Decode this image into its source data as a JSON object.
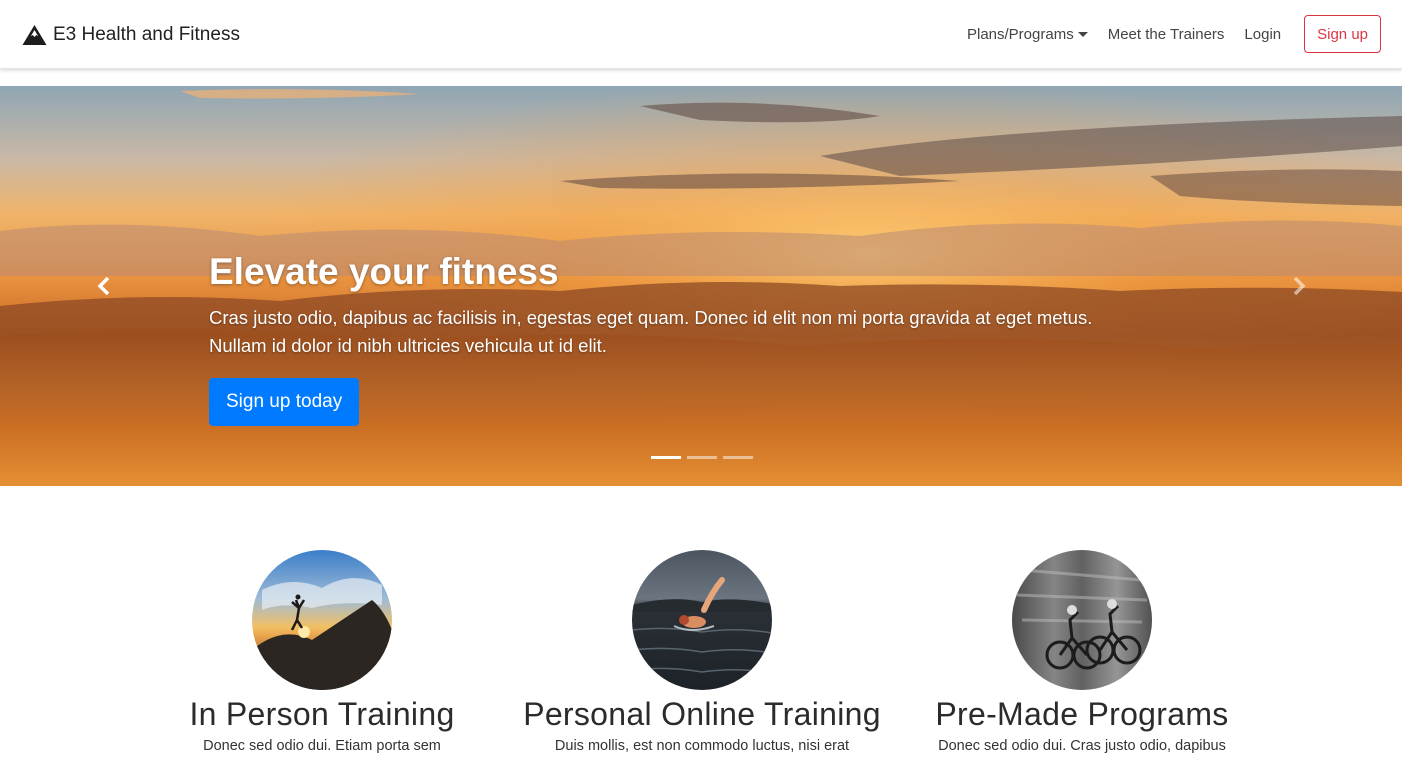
{
  "brand": {
    "name": "E3 Health and Fitness",
    "icon": "mountain-icon"
  },
  "nav": {
    "plans": "Plans/Programs",
    "trainers": "Meet the Trainers",
    "login": "Login",
    "signup": "Sign up"
  },
  "hero": {
    "title": "Elevate your fitness",
    "text_line1": "Cras justo odio, dapibus ac facilisis in, egestas eget quam. Donec id elit non mi porta gravida at eget metus.",
    "text_line2": "Nullam id dolor id nibh ultricies vehicula ut id elit.",
    "cta": "Sign up today",
    "slide_count": 3,
    "active_slide": 1
  },
  "features": [
    {
      "title": "In Person Training",
      "text": "Donec sed odio dui. Etiam porta sem"
    },
    {
      "title": "Personal Online Training",
      "text": "Duis mollis, est non commodo luctus, nisi erat"
    },
    {
      "title": "Pre-Made Programs",
      "text": "Donec sed odio dui. Cras justo odio, dapibus"
    }
  ],
  "colors": {
    "primary": "#007bff",
    "danger": "#dc3545",
    "navbar_bg": "#ffffff"
  }
}
